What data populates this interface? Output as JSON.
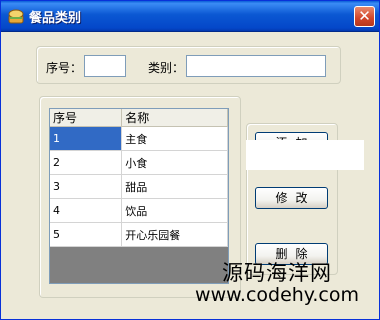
{
  "window": {
    "title": "餐品类别",
    "close_label": "✕"
  },
  "form": {
    "seq_label": "序号：",
    "seq_value": "",
    "category_label": "类别：",
    "category_value": ""
  },
  "grid": {
    "columns": [
      "序号",
      "名称"
    ],
    "rows": [
      {
        "id": "1",
        "name": "主食"
      },
      {
        "id": "2",
        "name": "小食"
      },
      {
        "id": "3",
        "name": "甜品"
      },
      {
        "id": "4",
        "name": "饮品"
      },
      {
        "id": "5",
        "name": "开心乐园餐"
      }
    ]
  },
  "buttons": {
    "add": "添加",
    "edit": "修改",
    "delete": "删除"
  },
  "watermark": {
    "line1": "源码海洋网",
    "line2": "www.codehy.com"
  }
}
